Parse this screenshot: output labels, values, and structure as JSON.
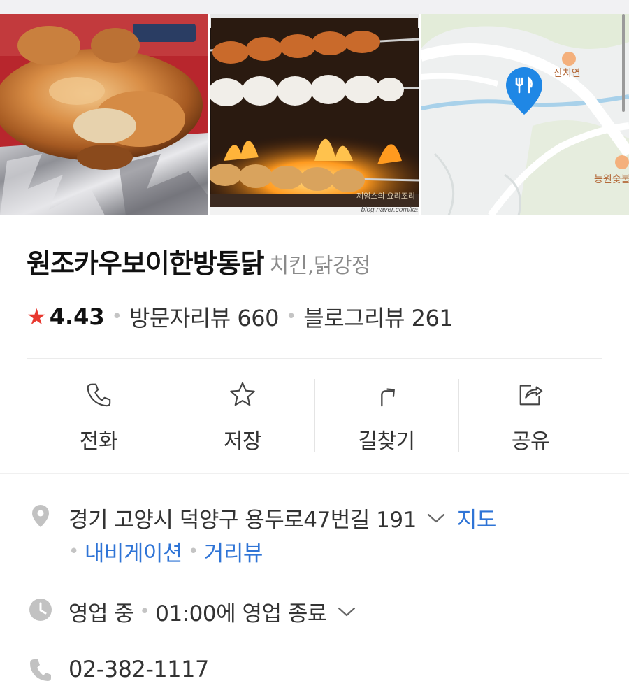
{
  "place": {
    "name": "원조카우보이한방통닭",
    "category": "치킨,닭강정"
  },
  "stats": {
    "rating": "4.43",
    "visitor_reviews": "방문자리뷰 660",
    "blog_reviews": "블로그리뷰 261"
  },
  "photos": {
    "watermark": "blog.naver.com/ka",
    "overlay_text": "제임스의 요리조리"
  },
  "map": {
    "poi_1": "잔치연",
    "poi_2": "능원숯불"
  },
  "actions": [
    {
      "label": "전화",
      "icon": "phone-icon"
    },
    {
      "label": "저장",
      "icon": "star-outline-icon"
    },
    {
      "label": "길찾기",
      "icon": "directions-icon"
    },
    {
      "label": "공유",
      "icon": "share-icon"
    }
  ],
  "info": {
    "address": "경기 고양시 덕양구 용두로47번길 191",
    "map_link": "지도",
    "navigation_link": "내비게이션",
    "street_view_link": "거리뷰",
    "hours_status": "영업 중",
    "hours_detail": "01:00에 영업 종료",
    "phone": "02-382-1117"
  },
  "colors": {
    "accent": "#2f74d6",
    "star": "#e8382f",
    "map_pin": "#1f87e5"
  }
}
